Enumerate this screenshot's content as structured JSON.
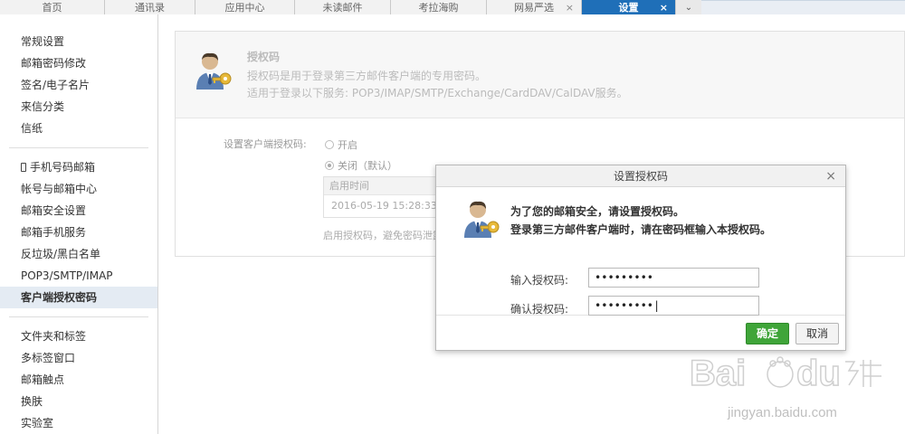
{
  "tabs": [
    {
      "label": "首页",
      "width": 116,
      "closable": false
    },
    {
      "label": "通讯录",
      "width": 100,
      "closable": false
    },
    {
      "label": "应用中心",
      "width": 110,
      "closable": false
    },
    {
      "label": "未读邮件",
      "width": 106,
      "closable": false
    },
    {
      "label": "考拉海购",
      "width": 106,
      "closable": false
    },
    {
      "label": "网易严选",
      "width": 105,
      "closable": true
    },
    {
      "label": "设置",
      "width": 104,
      "closable": true,
      "active": true
    }
  ],
  "tab_close_glyph": "×",
  "tab_more_glyph": "⌄",
  "sidebar": {
    "group1": [
      "常规设置",
      "邮箱密码修改",
      "签名/电子名片",
      "来信分类",
      "信纸"
    ],
    "group2": [
      "手机号码邮箱",
      "帐号与邮箱中心",
      "邮箱安全设置",
      "邮箱手机服务",
      "反垃圾/黑白名单",
      "POP3/SMTP/IMAP",
      "客户端授权密码"
    ],
    "group3": [
      "文件夹和标签",
      "多标签窗口",
      "邮箱触点",
      "换肤",
      "实验室"
    ],
    "active": "客户端授权密码"
  },
  "panel": {
    "title": "授权码",
    "desc1": "授权码是用于登录第三方邮件客户端的专用密码。",
    "desc2": "适用于登录以下服务: POP3/IMAP/SMTP/Exchange/CardDAV/CalDAV服务。",
    "set_label": "设置客户端授权码:",
    "opt_on": "开启",
    "opt_off": "关闭（默认）",
    "time_head": "启用时间",
    "time_value": "2016-05-19 15:28:33",
    "footnote": "启用授权码，避免密码泄露"
  },
  "dialog": {
    "title": "设置授权码",
    "close": "×",
    "line1": "为了您的邮箱安全，请设置授权码。",
    "line2": "登录第三方邮件客户端时，请在密码框输入本授权码。",
    "label_enter": "输入授权码:",
    "label_confirm": "确认授权码:",
    "value_enter": "•••••••••",
    "value_confirm": "•••••••••|",
    "ok": "确定",
    "cancel": "取消"
  },
  "watermark": {
    "text": "jingyan.baidu.com"
  },
  "colors": {
    "tab_active": "#1f6fb8",
    "ok_green": "#3fa539",
    "sidebar_active": "#e4ebf3"
  }
}
